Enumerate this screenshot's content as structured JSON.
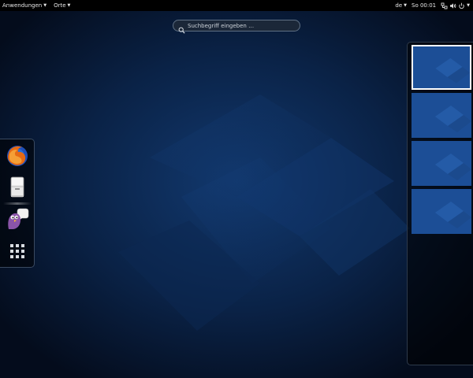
{
  "topbar": {
    "activities_menu": "Anwendungen",
    "places_menu": "Orte",
    "keyboard_layout": "de",
    "clock": "So 00:01",
    "icons": [
      "network-icon",
      "volume-icon",
      "power-icon"
    ]
  },
  "search": {
    "placeholder": "Suchbegriff eingeben …"
  },
  "dash": {
    "apps": [
      {
        "name": "Firefox",
        "icon": "firefox-icon",
        "running": false
      },
      {
        "name": "Dateien",
        "icon": "files-icon",
        "running": true
      },
      {
        "name": "Pidgin",
        "icon": "pidgin-icon",
        "running": false
      },
      {
        "name": "Anwendungen anzeigen",
        "icon": "app-grid-icon",
        "running": false
      }
    ]
  },
  "workspaces": {
    "count": 4,
    "active_index": 0
  },
  "colors": {
    "panel": "#000000",
    "background_dark": "#061226",
    "background_mid": "#0f3a73",
    "workspace_thumb": "#1a4a91"
  }
}
